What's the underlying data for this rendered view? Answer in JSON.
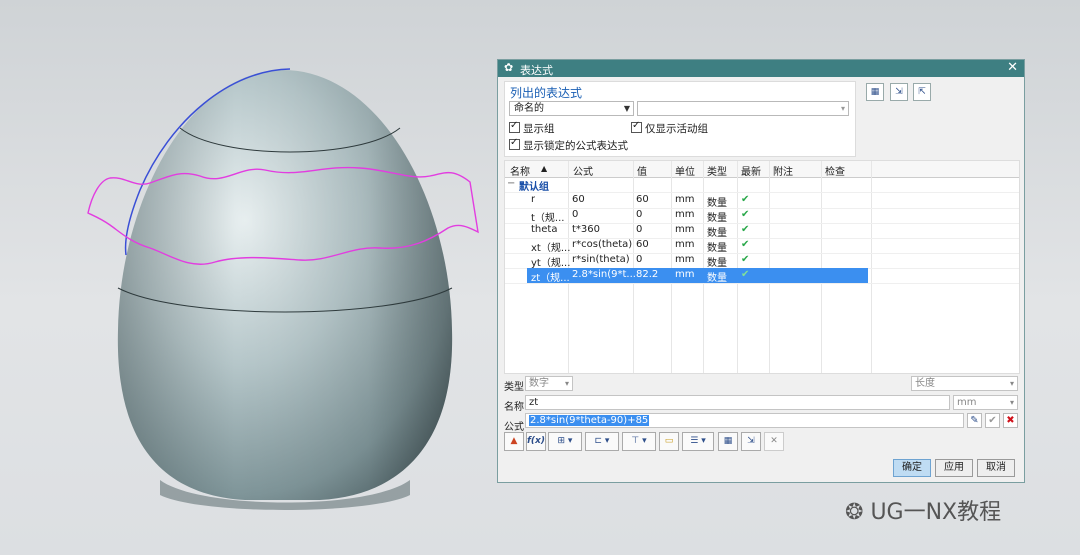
{
  "dialog": {
    "title": "表达式",
    "list_group_title": "列出的表达式",
    "filter_value": "命名的",
    "filter2_value": "",
    "cb_show_group": "显示组",
    "cb_active_only": "仅显示活动组",
    "cb_show_locked": "显示锁定的公式表达式"
  },
  "table": {
    "headers": [
      "名称",
      "公式",
      "值",
      "单位",
      "类型",
      "最新",
      "附注",
      "检查"
    ],
    "group_label": "默认组",
    "rows": [
      {
        "name": "r",
        "formula": "60",
        "value": "60",
        "unit": "mm",
        "type": "数量"
      },
      {
        "name": "t（规...",
        "formula": "0",
        "value": "0",
        "unit": "mm",
        "type": "数量"
      },
      {
        "name": "theta",
        "formula": "t*360",
        "value": "0",
        "unit": "mm",
        "type": "数量"
      },
      {
        "name": "xt（规...",
        "formula": "r*cos(theta)",
        "value": "60",
        "unit": "mm",
        "type": "数量"
      },
      {
        "name": "yt（规...",
        "formula": "r*sin(theta)",
        "value": "0",
        "unit": "mm",
        "type": "数量"
      },
      {
        "name": "zt（规...",
        "formula": "2.8*sin(9*t...",
        "value": "82.2",
        "unit": "mm",
        "type": "数量"
      }
    ]
  },
  "editor": {
    "type_label": "类型",
    "type_value": "数字",
    "dimension_value": "长度",
    "name_label": "名称",
    "name_value": "zt",
    "unit_value": "mm",
    "formula_label": "公式",
    "formula_value": "2.8*sin(9*theta-90)+85"
  },
  "buttons": {
    "ok": "确定",
    "apply": "应用",
    "cancel": "取消",
    "fx": "f(x)"
  },
  "watermark": "UG一NX教程",
  "colors": {
    "titlebar": "#3e7f82",
    "selection": "#3b8ff0",
    "curve_magenta": "#e23de0",
    "curve_blue": "#3a4fd6"
  }
}
